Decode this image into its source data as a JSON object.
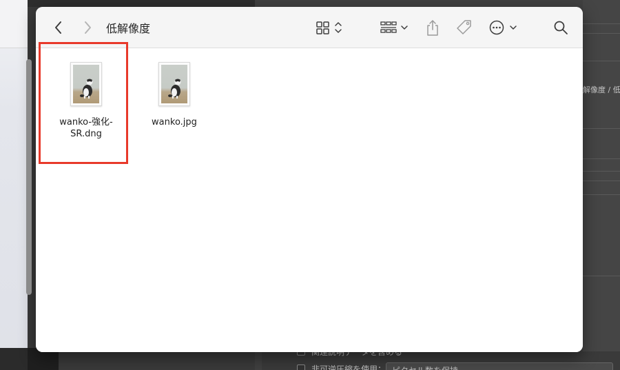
{
  "finder": {
    "title": "低解像度",
    "files": [
      {
        "name_line1": "wanko-強化-",
        "name_line2": "SR.dng"
      },
      {
        "name_line1": "wanko.jpg",
        "name_line2": ""
      }
    ]
  },
  "background_app": {
    "path_fragment": "解像度 / 低解",
    "option_row1": "関連説明データを含める",
    "option_row2_label": "非可逆圧縮を使用：",
    "option_row2_value": "ピクセル数を保持"
  },
  "colors": {
    "highlight": "#e8392a",
    "toolbar_bg": "#f5f5f5",
    "content_bg": "#ffffff"
  }
}
